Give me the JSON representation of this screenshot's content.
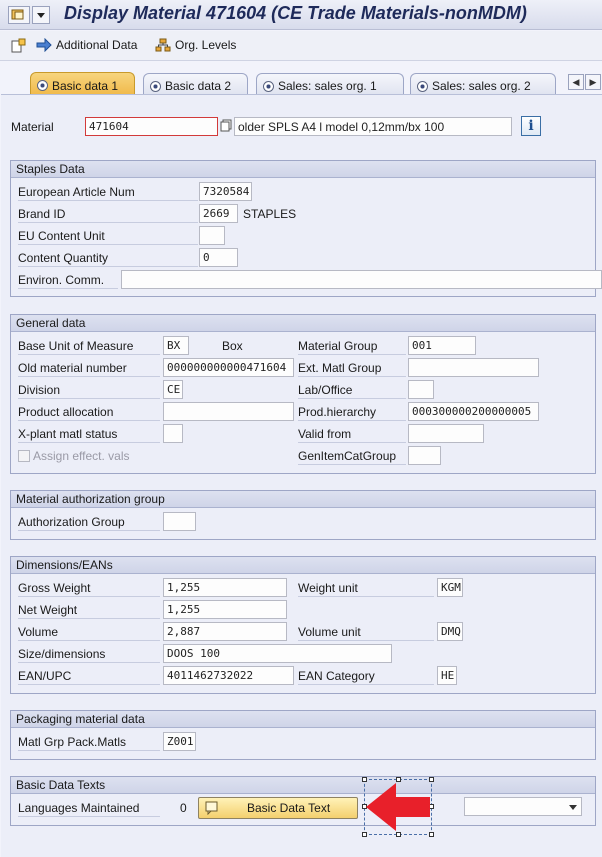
{
  "window": {
    "title": "Display Material 471604 (CE Trade Materials-nonMDM)"
  },
  "toolbar": {
    "additional_data": "Additional Data",
    "org_levels": "Org. Levels"
  },
  "tabs": [
    {
      "label": "Basic data 1",
      "active": true
    },
    {
      "label": "Basic data 2",
      "active": false
    },
    {
      "label": "Sales: sales org. 1",
      "active": false
    },
    {
      "label": "Sales: sales org. 2",
      "active": false
    }
  ],
  "header": {
    "material_label": "Material",
    "material_value": "471604",
    "material_desc": "older SPLS A4 l model 0,12mm/bx 100"
  },
  "staples": {
    "title": "Staples Data",
    "ean_label": "European Article Num",
    "ean_value": "7320584",
    "brand_label": "Brand ID",
    "brand_value": "2669",
    "brand_text": "STAPLES",
    "eu_label": "EU Content Unit",
    "eu_value": "",
    "qty_label": "Content Quantity",
    "qty_value": "0",
    "env_label": "Environ. Comm.",
    "env_value": ""
  },
  "general": {
    "title": "General data",
    "bum_label": "Base Unit of Measure",
    "bum_value": "BX",
    "bum_text": "Box",
    "matgrp_label": "Material Group",
    "matgrp_value": "001",
    "old_label": "Old material number",
    "old_value": "000000000000471604",
    "extgrp_label": "Ext. Matl Group",
    "extgrp_value": "",
    "div_label": "Division",
    "div_value": "CE",
    "lab_label": "Lab/Office",
    "lab_value": "",
    "alloc_label": "Product allocation",
    "alloc_value": "",
    "hier_label": "Prod.hierarchy",
    "hier_value": "000300000200000005",
    "xplant_label": "X-plant matl status",
    "xplant_value": "",
    "valid_label": "Valid from",
    "valid_value": "",
    "assign_label": "Assign effect. vals",
    "gencat_label": "GenItemCatGroup",
    "gencat_value": ""
  },
  "auth": {
    "title": "Material authorization group",
    "group_label": "Authorization Group",
    "group_value": ""
  },
  "dims": {
    "title": "Dimensions/EANs",
    "gross_label": "Gross Weight",
    "gross_value": "1,255",
    "wunit_label": "Weight unit",
    "wunit_value": "KGM",
    "net_label": "Net Weight",
    "net_value": "1,255",
    "vol_label": "Volume",
    "vol_value": "2,887",
    "vunit_label": "Volume unit",
    "vunit_value": "DMQ",
    "size_label": "Size/dimensions",
    "size_value": "DOOS 100",
    "ean_label": "EAN/UPC",
    "ean_value": "4011462732022",
    "eancat_label": "EAN Category",
    "eancat_value": "HE"
  },
  "packaging": {
    "title": "Packaging material data",
    "grp_label": "Matl Grp Pack.Matls",
    "grp_value": "Z001"
  },
  "texts": {
    "title": "Basic Data Texts",
    "lang_label": "Languages Maintained",
    "lang_count": "0",
    "button_label": "Basic Data Text",
    "dropdown_value": ""
  },
  "colors": {
    "annotation_arrow": "#e8202a",
    "button_fill": "#f4d06e",
    "active_tab": "#f0b94a"
  }
}
